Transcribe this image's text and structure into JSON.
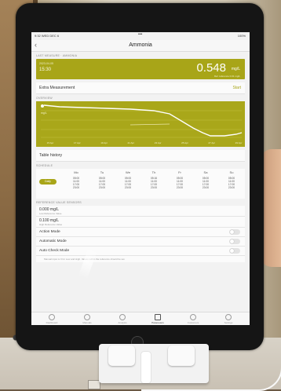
{
  "status_bar": {
    "time": "9:32  WED DEC 6",
    "battery": "100%"
  },
  "nav": {
    "back": "‹",
    "title": "Ammonia"
  },
  "last_measure": {
    "section_label": "LAST MEASURE · AMMONIA",
    "date": "2023-04-05",
    "time": "15:30",
    "value": "0.548",
    "unit": "mg/L",
    "ref": "Ref. reference 0.01 mg/L"
  },
  "extra_measurement": {
    "label": "Extra Measurement",
    "action": "Start"
  },
  "overview": {
    "section_label": "OVERVIEW",
    "y_tag": "mg/L",
    "x_ticks": [
      "15 Apr",
      "17 Apr",
      "19 Apr",
      "21 Apr",
      "23 Apr",
      "25 Apr",
      "27 Apr",
      "29 Apr"
    ]
  },
  "table_history": {
    "label": "Table history"
  },
  "schedule": {
    "section_label": "SCHEDULE",
    "pill": "Daily",
    "days": [
      {
        "name": "Mo",
        "times": [
          "05:00",
          "11:00",
          "17:00",
          "23:00"
        ]
      },
      {
        "name": "Tu",
        "times": [
          "05:00",
          "11:00",
          "17:00",
          "23:00"
        ]
      },
      {
        "name": "We",
        "times": [
          "05:00",
          "11:00",
          "17:00",
          "23:00"
        ]
      },
      {
        "name": "Th",
        "times": [
          "05:16",
          "11:00",
          "17:00",
          "23:00"
        ]
      },
      {
        "name": "Fr",
        "times": [
          "05:00",
          "11:00",
          "17:00",
          "23:00"
        ]
      },
      {
        "name": "Sa",
        "times": [
          "05:00",
          "11:00",
          "17:00",
          "23:00"
        ]
      },
      {
        "name": "Su",
        "times": [
          "05:00",
          "11:00",
          "17:00",
          "23:00"
        ]
      }
    ]
  },
  "reference": {
    "section_label": "REFERENCE VALUE SENSORS",
    "low_value": "0.000 mg/L",
    "low_sub": "Low Reference Value",
    "high_value": "0.100 mg/L",
    "high_sub": "High Reference Value"
  },
  "modes": {
    "action": "Action Mode",
    "automatic": "Automatic Mode",
    "auto_check": "Auto Check Mode"
  },
  "footnote": "Manual input is 0 for Low and High. Values within the reference should be set.",
  "tabs": [
    {
      "label": "Dashboard"
    },
    {
      "label": "Manuals"
    },
    {
      "label": "Analysis"
    },
    {
      "label": "Parameters"
    },
    {
      "label": "Customers"
    },
    {
      "label": "Settings"
    }
  ],
  "colors": {
    "accent": "#a8a518",
    "bezel": "#151515"
  }
}
